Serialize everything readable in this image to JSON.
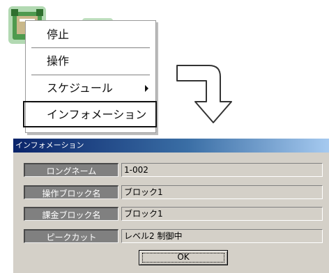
{
  "context_menu": {
    "items": [
      {
        "label": "停止"
      },
      {
        "label": "操作"
      },
      {
        "label": "スケジュール"
      },
      {
        "label": "インフォメーション"
      }
    ]
  },
  "dialog": {
    "title": "インフォメーション",
    "fields": [
      {
        "label": "ロングネーム",
        "value": "1-002"
      },
      {
        "label": "操作ブロック名",
        "value": "ブロック1"
      },
      {
        "label": "課金ブロック名",
        "value": "ブロック1"
      },
      {
        "label": "ピークカット",
        "value": "レベル2 制御中"
      }
    ],
    "ok_label": "OK"
  },
  "colors": {
    "titlebar_start": "#0a246a",
    "titlebar_end": "#a6caf0",
    "dialog_bg": "#d4d0c8",
    "label_bg": "#808080"
  }
}
